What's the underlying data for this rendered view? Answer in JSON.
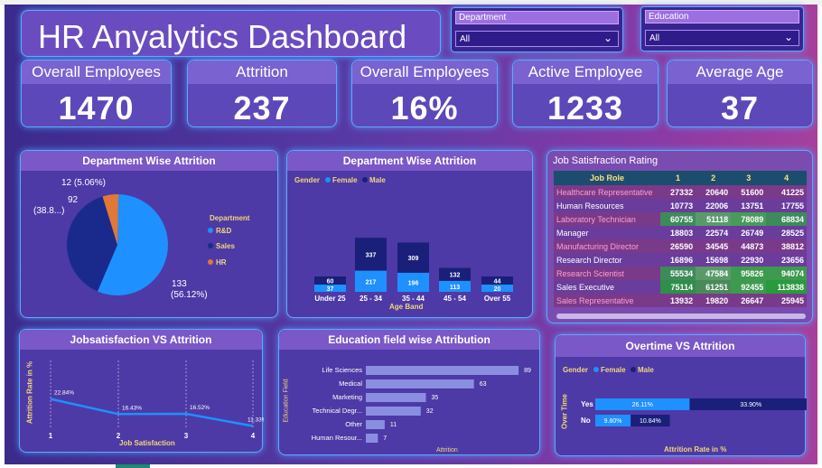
{
  "title": "HR Anyalytics Dashboard",
  "slicers": [
    {
      "label": "Department",
      "value": "All"
    },
    {
      "label": "Education",
      "value": "All"
    }
  ],
  "kpis": [
    {
      "label": "Overall Employees",
      "value": "1470"
    },
    {
      "label": "Attrition",
      "value": "237"
    },
    {
      "label": "Overall Employees",
      "value": "16%"
    },
    {
      "label": "Active Employee",
      "value": "1233"
    },
    {
      "label": "Average Age",
      "value": "37"
    }
  ],
  "colors": {
    "rnd": "#1e90ff",
    "sales": "#1a2a8c",
    "hr": "#e07838",
    "female": "#1e90ff",
    "male": "#1a1f7a"
  },
  "pie": {
    "title": "Department Wise Attrition",
    "legend_title": "Department",
    "labels": {
      "hr": "12 (5.06%)",
      "sales_a": "92",
      "sales_b": "(38.8...)",
      "rnd_a": "133",
      "rnd_b": "(56.12%)"
    },
    "legend": [
      "R&D",
      "Sales",
      "HR"
    ]
  },
  "ageband": {
    "title": "Department Wise Attrition",
    "gender_label": "Gender",
    "female": "Female",
    "male": "Male",
    "xlabel": "Age Band"
  },
  "jobsat": {
    "title": "Job Satisfraction Rating",
    "headers": [
      "Job Role",
      "1",
      "2",
      "3",
      "4"
    ],
    "rows": [
      [
        "Healthcare Representative",
        "27332",
        "20640",
        "51600",
        "41225"
      ],
      [
        "Human Resources",
        "10773",
        "22006",
        "13751",
        "17755"
      ],
      [
        "Laboratory Technician",
        "60755",
        "51118",
        "78089",
        "68834"
      ],
      [
        "Manager",
        "18803",
        "22574",
        "26749",
        "28525"
      ],
      [
        "Manufacturing Director",
        "26590",
        "34545",
        "44873",
        "38812"
      ],
      [
        "Research Director",
        "16896",
        "15698",
        "22930",
        "23656"
      ],
      [
        "Research Scientist",
        "55534",
        "47584",
        "95826",
        "94074"
      ],
      [
        "Sales Executive",
        "75114",
        "61251",
        "92455",
        "113838"
      ],
      [
        "Sales Representative",
        "13932",
        "19820",
        "26647",
        "25945"
      ]
    ]
  },
  "line": {
    "title": "Jobsatisfaction VS Attrition",
    "ylabel": "Attrition Rate in %",
    "xlabel": "Job Satisfaction"
  },
  "edu": {
    "title": "Education field wise Attribution",
    "ylabel": "Education Field",
    "xlabel": "Attrition"
  },
  "overtime": {
    "title": "Overtime VS Attrition",
    "gender_label": "Gender",
    "female": "Female",
    "male": "Male",
    "ylabel": "Over Time",
    "xlabel": "Attrition Rate in %"
  },
  "chart_data": [
    {
      "type": "pie",
      "title": "Department Wise Attrition",
      "categories": [
        "R&D",
        "Sales",
        "HR"
      ],
      "values": [
        133,
        92,
        12
      ],
      "percents": [
        56.12,
        38.82,
        5.06
      ]
    },
    {
      "type": "bar",
      "title": "Department Wise Attrition",
      "xlabel": "Age Band",
      "categories": [
        "Under 25",
        "25 - 34",
        "35 - 44",
        "45 - 54",
        "Over 55"
      ],
      "series": [
        {
          "name": "Female",
          "values": [
            37,
            217,
            196,
            113,
            20
          ]
        },
        {
          "name": "Male",
          "values": [
            60,
            337,
            309,
            132,
            44
          ]
        }
      ]
    },
    {
      "type": "line",
      "title": "Jobsatisfaction VS Attrition",
      "xlabel": "Job Satisfaction",
      "ylabel": "Attrition Rate in %",
      "x": [
        1,
        2,
        3,
        4
      ],
      "y": [
        22.84,
        16.43,
        16.52,
        11.33
      ],
      "labels": [
        "22.84%",
        "16.43%",
        "16.52%",
        "11.33%"
      ]
    },
    {
      "type": "bar",
      "title": "Education field wise Attribution",
      "xlabel": "Attrition",
      "ylabel": "Education Field",
      "categories": [
        "Life Sciences",
        "Medical",
        "Marketing",
        "Technical Degr...",
        "Other",
        "Human Resour..."
      ],
      "values": [
        89,
        63,
        35,
        32,
        11,
        7
      ]
    },
    {
      "type": "bar",
      "title": "Overtime VS Attrition",
      "xlabel": "Attrition Rate in %",
      "ylabel": "Over Time",
      "categories": [
        "Yes",
        "No"
      ],
      "series": [
        {
          "name": "Female",
          "values": [
            26.11,
            9.8
          ],
          "labels": [
            "26.11%",
            "9.80%"
          ]
        },
        {
          "name": "Male",
          "values": [
            33.9,
            10.84
          ],
          "labels": [
            "33.90%",
            "10.84%"
          ]
        }
      ]
    }
  ]
}
